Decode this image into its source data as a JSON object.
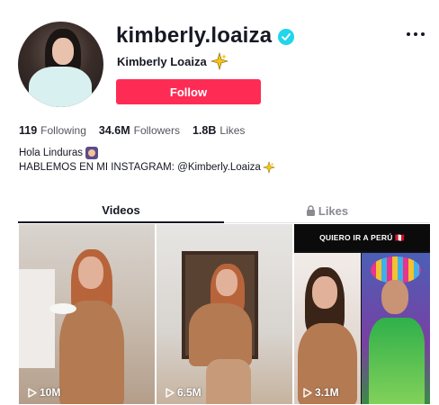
{
  "profile": {
    "username": "kimberly.loaiza",
    "display_name": "Kimberly Loaiza",
    "follow_label": "Follow",
    "stats": {
      "following_count": "119",
      "following_label": "Following",
      "followers_count": "34.6M",
      "followers_label": "Followers",
      "likes_count": "1.8B",
      "likes_label": "Likes"
    },
    "bio": {
      "line1": "Hola Linduras",
      "line2": "HABLEMOS EN MI INSTAGRAM: @Kimberly.Loaiza"
    }
  },
  "tabs": {
    "videos": "Videos",
    "likes": "Likes"
  },
  "videos": [
    {
      "views": "10M"
    },
    {
      "views": "6.5M"
    },
    {
      "views": "3.1M",
      "caption": "QUIERO IR A PERÚ 🇵🇪"
    }
  ],
  "colors": {
    "accent": "#fe2c55",
    "verified": "#20d5ec",
    "text": "#161823",
    "muted": "#8a8b91"
  },
  "icons": {
    "verified": "verified-badge-icon",
    "more": "more-options-icon",
    "lock": "lock-icon",
    "play": "play-icon",
    "sparkle": "sparkle-emoji-icon"
  }
}
